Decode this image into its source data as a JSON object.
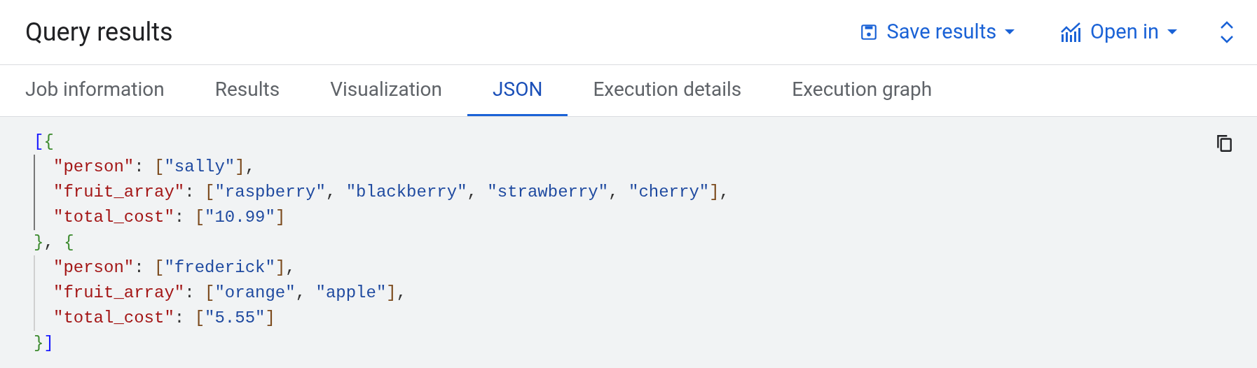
{
  "header": {
    "title": "Query results",
    "actions": [
      {
        "kind": "save",
        "label": "Save results"
      },
      {
        "kind": "chart",
        "label": "Open in"
      }
    ]
  },
  "tabs": [
    {
      "label": "Job information",
      "selected": false
    },
    {
      "label": "Results",
      "selected": false
    },
    {
      "label": "Visualization",
      "selected": false
    },
    {
      "label": "JSON",
      "selected": true
    },
    {
      "label": "Execution details",
      "selected": false
    },
    {
      "label": "Execution graph",
      "selected": false
    }
  ],
  "code_lines": [
    {
      "tokens": [
        {
          "kind": "bracket",
          "text": "["
        },
        {
          "kind": "brace",
          "text": "{"
        }
      ]
    },
    {
      "guide_active": true,
      "tokens": [
        {
          "kind": "key",
          "text": "\"person\""
        },
        {
          "kind": "punct",
          "text": ": "
        },
        {
          "kind": "array",
          "text": "["
        },
        {
          "kind": "string",
          "text": "\"sally\""
        },
        {
          "kind": "array",
          "text": "]"
        },
        {
          "kind": "punct",
          "text": ","
        }
      ]
    },
    {
      "guide_active": true,
      "tokens": [
        {
          "kind": "key",
          "text": "\"fruit_array\""
        },
        {
          "kind": "punct",
          "text": ": "
        },
        {
          "kind": "array",
          "text": "["
        },
        {
          "kind": "string",
          "text": "\"raspberry\""
        },
        {
          "kind": "punct",
          "text": ", "
        },
        {
          "kind": "string",
          "text": "\"blackberry\""
        },
        {
          "kind": "punct",
          "text": ", "
        },
        {
          "kind": "string",
          "text": "\"strawberry\""
        },
        {
          "kind": "punct",
          "text": ", "
        },
        {
          "kind": "string",
          "text": "\"cherry\""
        },
        {
          "kind": "array",
          "text": "]"
        },
        {
          "kind": "punct",
          "text": ","
        }
      ]
    },
    {
      "guide_active": true,
      "tokens": [
        {
          "kind": "key",
          "text": "\"total_cost\""
        },
        {
          "kind": "punct",
          "text": ": "
        },
        {
          "kind": "array",
          "text": "["
        },
        {
          "kind": "string",
          "text": "\"10.99\""
        },
        {
          "kind": "array",
          "text": "]"
        }
      ]
    },
    {
      "tokens": [
        {
          "kind": "brace",
          "text": "}"
        },
        {
          "kind": "punct",
          "text": ", "
        },
        {
          "kind": "brace",
          "text": "{"
        }
      ]
    },
    {
      "guide_active": false,
      "tokens": [
        {
          "kind": "key",
          "text": "\"person\""
        },
        {
          "kind": "punct",
          "text": ": "
        },
        {
          "kind": "array",
          "text": "["
        },
        {
          "kind": "string",
          "text": "\"frederick\""
        },
        {
          "kind": "array",
          "text": "]"
        },
        {
          "kind": "punct",
          "text": ","
        }
      ]
    },
    {
      "guide_active": false,
      "tokens": [
        {
          "kind": "key",
          "text": "\"fruit_array\""
        },
        {
          "kind": "punct",
          "text": ": "
        },
        {
          "kind": "array",
          "text": "["
        },
        {
          "kind": "string",
          "text": "\"orange\""
        },
        {
          "kind": "punct",
          "text": ", "
        },
        {
          "kind": "string",
          "text": "\"apple\""
        },
        {
          "kind": "array",
          "text": "]"
        },
        {
          "kind": "punct",
          "text": ","
        }
      ]
    },
    {
      "guide_active": false,
      "tokens": [
        {
          "kind": "key",
          "text": "\"total_cost\""
        },
        {
          "kind": "punct",
          "text": ": "
        },
        {
          "kind": "array",
          "text": "["
        },
        {
          "kind": "string",
          "text": "\"5.55\""
        },
        {
          "kind": "array",
          "text": "]"
        }
      ]
    },
    {
      "tokens": [
        {
          "kind": "brace",
          "text": "}"
        },
        {
          "kind": "bracket",
          "text": "]"
        }
      ]
    }
  ]
}
